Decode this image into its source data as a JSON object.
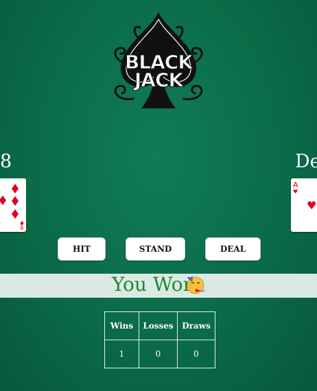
{
  "logo": {
    "text_line1": "BLACK",
    "text_line2": "JACK"
  },
  "player": {
    "score": "8",
    "card": {
      "rank": "6",
      "suit": "diamonds",
      "suit_symbol": "♦"
    }
  },
  "dealer": {
    "label": "De",
    "card": {
      "rank": "A",
      "suit": "hearts",
      "suit_symbol": "♥"
    }
  },
  "buttons": {
    "hit": "HIT",
    "stand": "STAND",
    "deal": "DEAL"
  },
  "result": {
    "message": "You Won",
    "emoji": "partying-face-icon"
  },
  "stats": {
    "headers": [
      "Wins",
      "Losses",
      "Draws"
    ],
    "values": [
      "1",
      "0",
      "0"
    ]
  },
  "colors": {
    "table_felt": "#0b6b48",
    "win_text": "#1f8a2c",
    "card_red": "#e0001b"
  }
}
